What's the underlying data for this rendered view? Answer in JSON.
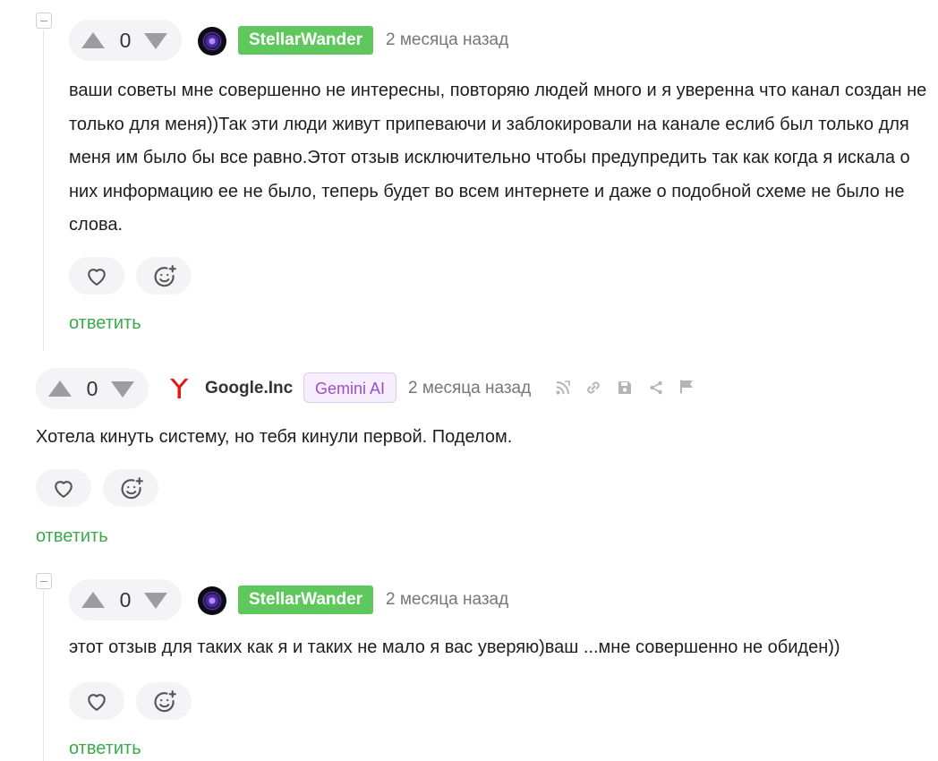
{
  "comments": [
    {
      "votes": "0",
      "author": "StellarWander",
      "time": "2 месяца назад",
      "text": "ваши советы мне совершенно не интересны, повторяю людей много и я уверенна что канал создан не только для меня))Так эти люди живут припеваючи и заблокировали на канале еслиб был только для меня им было бы все равно.Этот отзыв исключительно чтобы предупредить так как когда я искала о них информацию ее не было, теперь будет во всем интернете и даже о подобной схеме не было не слова.",
      "reply": "ответить"
    },
    {
      "votes": "0",
      "author": "Google.Inc",
      "badge": "Gemini AI",
      "time": "2 месяца назад",
      "text": "Хотела кинуть систему, но тебя кинули первой. Поделом.",
      "reply": "ответить"
    },
    {
      "votes": "0",
      "author": "StellarWander",
      "time": "2 месяца назад",
      "text": "этот отзыв для таких как я и таких не мало я вас уверяю)ваш ...мне совершенно не обиден))",
      "reply": "ответить"
    }
  ],
  "icons": {
    "like": "heart-icon",
    "emoji": "add-reaction-icon",
    "rss": "rss-icon",
    "link": "link-icon",
    "save": "save-icon",
    "share": "share-icon",
    "flag": "flag-icon",
    "yandex": "yandex-logo-icon"
  },
  "colors": {
    "accent_green": "#5fc85d",
    "reply_green": "#3aab4c",
    "badge_purple": "#9b4fc7"
  }
}
